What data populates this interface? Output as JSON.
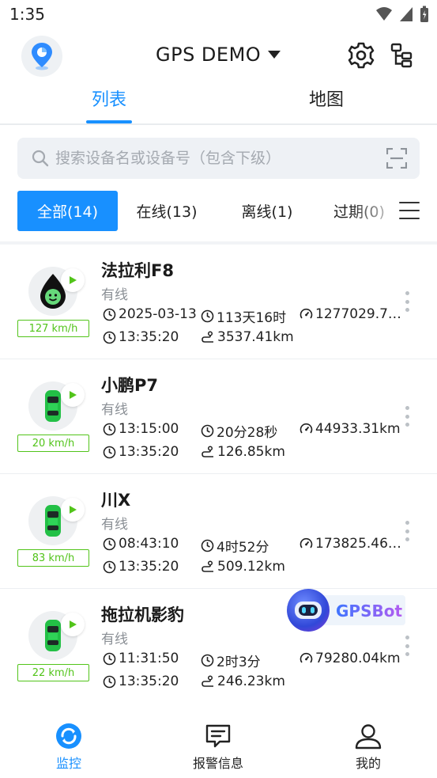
{
  "status_bar": {
    "time": "1:35"
  },
  "header": {
    "title": "GPS DEMO"
  },
  "tabs": [
    {
      "label": "列表"
    },
    {
      "label": "地图"
    }
  ],
  "search": {
    "placeholder": "搜索设备名或设备号（包含下级）"
  },
  "filters": [
    {
      "label": "全部(14)"
    },
    {
      "label": "在线(13)"
    },
    {
      "label": "离线(1)"
    },
    {
      "label": "过期(0)"
    }
  ],
  "devices": [
    {
      "name": "法拉利F8",
      "status": "有线",
      "speed": "127 km/h",
      "date": "2025-03-13",
      "duration": "113天16时",
      "mileage": "1277029.7…",
      "time": "13:35:20",
      "distance": "3537.41km",
      "icon": "droplet-face-icon"
    },
    {
      "name": "小鹏P7",
      "status": "有线",
      "speed": "20 km/h",
      "date": "13:15:00",
      "duration": "20分28秒",
      "mileage": "44933.31km",
      "time": "13:35:20",
      "distance": "126.85km",
      "icon": "car-icon"
    },
    {
      "name": "川X",
      "status": "有线",
      "speed": "83 km/h",
      "date": "08:43:10",
      "duration": "4时52分",
      "mileage": "173825.46…",
      "time": "13:35:20",
      "distance": "509.12km",
      "icon": "car-icon"
    },
    {
      "name": "拖拉机影豹",
      "status": "有线",
      "speed": "22 km/h",
      "date": "11:31:50",
      "duration": "2时3分",
      "mileage": "79280.04km",
      "time": "13:35:20",
      "distance": "246.23km",
      "icon": "car-icon"
    }
  ],
  "gpsbot": {
    "label": "GPSBot"
  },
  "bottom_nav": [
    {
      "label": "监控",
      "icon": "monitor-icon",
      "active": true
    },
    {
      "label": "报警信息",
      "icon": "alarm-message-icon",
      "active": false
    },
    {
      "label": "我的",
      "icon": "user-icon",
      "active": false
    }
  ],
  "colors": {
    "accent": "#1890ff",
    "online": "#52c41a"
  }
}
